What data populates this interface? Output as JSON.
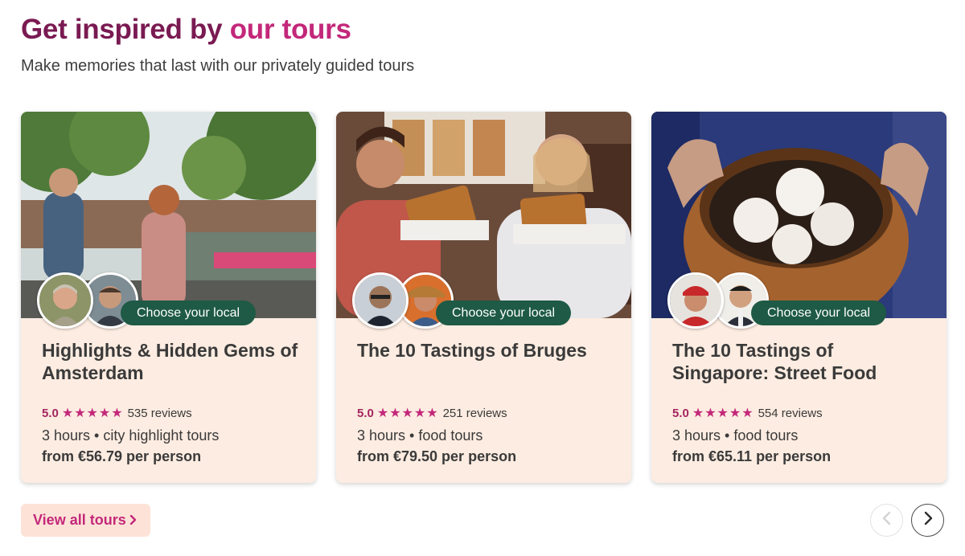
{
  "header": {
    "title_main": "Get inspired by",
    "title_accent": "our tours",
    "subtitle": "Make memories that last with our privately guided tours"
  },
  "tours": [
    {
      "title": "Highlights & Hidden Gems of Amsterdam",
      "choose_label": "Choose your local",
      "rating": "5.0",
      "stars": "★★★★★",
      "reviews": "535 reviews",
      "meta": "3 hours • city highlight tours",
      "price": "from €56.79 per person"
    },
    {
      "title": "The 10 Tastings of Bruges",
      "choose_label": "Choose your local",
      "rating": "5.0",
      "stars": "★★★★★",
      "reviews": "251 reviews",
      "meta": "3 hours • food tours",
      "price": "from €79.50 per person"
    },
    {
      "title": "The 10 Tastings of Singapore: Street Food",
      "choose_label": "Choose your local",
      "rating": "5.0",
      "stars": "★★★★★",
      "reviews": "554 reviews",
      "meta": "3 hours • food tours",
      "price": "from €65.11 per person"
    }
  ],
  "footer": {
    "view_all_label": "View all tours",
    "view_all_icon": "chevron-right-icon",
    "prev_icon": "chevron-left-icon",
    "next_icon": "chevron-right-icon"
  },
  "colors": {
    "heading": "#7a1a52",
    "accent": "#c3287a",
    "card_bg": "#fdece1",
    "chip_bg": "#1e5a45"
  }
}
